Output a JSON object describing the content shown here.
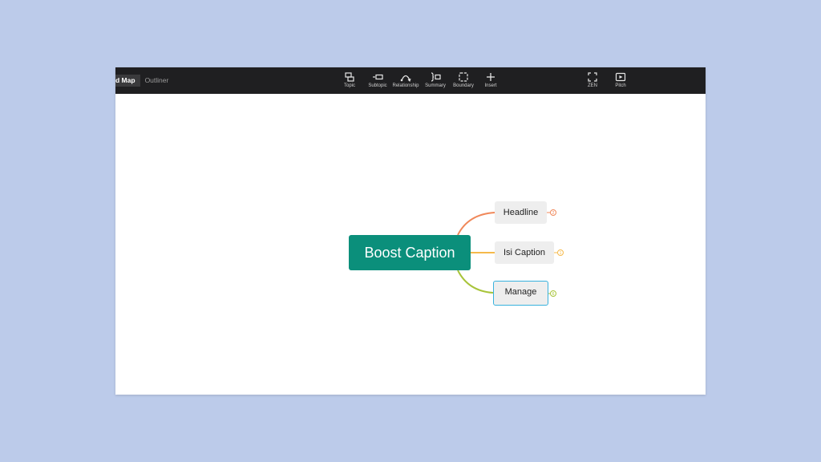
{
  "toolbar": {
    "view_tabs": [
      {
        "label": "d Map",
        "active": true
      },
      {
        "label": "Outliner",
        "active": false
      }
    ],
    "tools": [
      {
        "label": "Topic",
        "icon": "topic-icon"
      },
      {
        "label": "Subtopic",
        "icon": "subtopic-icon"
      },
      {
        "label": "Relationship",
        "icon": "relationship-icon"
      },
      {
        "label": "Summary",
        "icon": "summary-icon"
      },
      {
        "label": "Boundary",
        "icon": "boundary-icon"
      },
      {
        "label": "Insert",
        "icon": "plus-icon"
      }
    ],
    "right_tools": [
      {
        "label": "ZEN",
        "icon": "fullscreen-icon"
      },
      {
        "label": "Pitch",
        "icon": "play-icon"
      }
    ]
  },
  "mindmap": {
    "central_topic": "Boost Caption",
    "central_color": "#0b8f7b",
    "branches": [
      {
        "label": "Headline",
        "badge": "2",
        "color": "#f0885a"
      },
      {
        "label": "Isi Caption",
        "badge": "1",
        "color": "#f5b94a"
      },
      {
        "label": "Manage",
        "badge": "6",
        "color": "#a8c43a",
        "selected": true
      }
    ]
  },
  "colors": {
    "background": "#bccbea",
    "toolbar": "#1f1f21",
    "selection": "#38b2de"
  }
}
